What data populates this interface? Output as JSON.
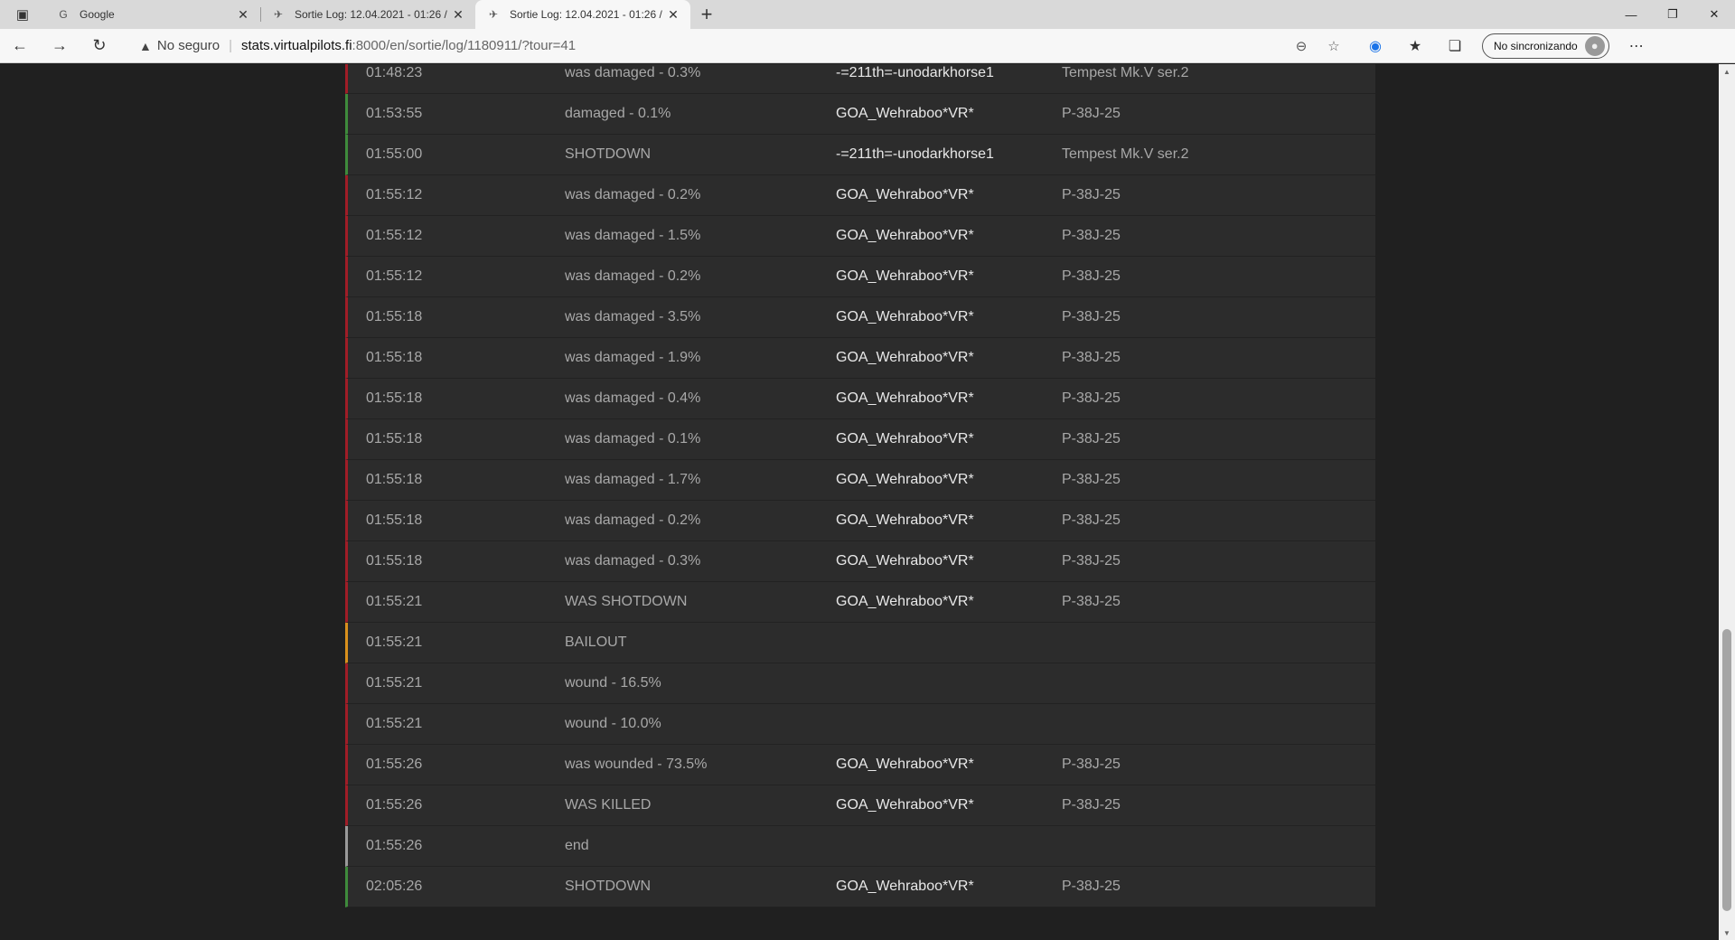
{
  "tabs": [
    {
      "title": "Google",
      "active": false
    },
    {
      "title": "Sortie Log: 12.04.2021 - 01:26 / ",
      "active": false
    },
    {
      "title": "Sortie Log: 12.04.2021 - 01:26 / ",
      "active": true
    }
  ],
  "address": {
    "security_label": "No seguro",
    "host": "stats.virtualpilots.fi",
    "path": ":8000/en/sortie/log/1180911/?tour=41"
  },
  "profile": {
    "label": "No sincronizando"
  },
  "log_rows": [
    {
      "time": "01:48:23",
      "event": "was damaged - 0.3%",
      "pilot": "-=211th=-unodarkhorse1",
      "aircraft": "Tempest Mk.V ser.2",
      "status_color": "#a01d27"
    },
    {
      "time": "01:53:55",
      "event": "damaged - 0.1%",
      "pilot": "GOA_Wehraboo*VR*",
      "aircraft": "P-38J-25",
      "status_color": "#3e8a3b"
    },
    {
      "time": "01:55:00",
      "event": "SHOTDOWN",
      "pilot": "-=211th=-unodarkhorse1",
      "aircraft": "Tempest Mk.V ser.2",
      "status_color": "#3e8a3b"
    },
    {
      "time": "01:55:12",
      "event": "was damaged - 0.2%",
      "pilot": "GOA_Wehraboo*VR*",
      "aircraft": "P-38J-25",
      "status_color": "#a01d27"
    },
    {
      "time": "01:55:12",
      "event": "was damaged - 1.5%",
      "pilot": "GOA_Wehraboo*VR*",
      "aircraft": "P-38J-25",
      "status_color": "#a01d27"
    },
    {
      "time": "01:55:12",
      "event": "was damaged - 0.2%",
      "pilot": "GOA_Wehraboo*VR*",
      "aircraft": "P-38J-25",
      "status_color": "#a01d27"
    },
    {
      "time": "01:55:18",
      "event": "was damaged - 3.5%",
      "pilot": "GOA_Wehraboo*VR*",
      "aircraft": "P-38J-25",
      "status_color": "#a01d27"
    },
    {
      "time": "01:55:18",
      "event": "was damaged - 1.9%",
      "pilot": "GOA_Wehraboo*VR*",
      "aircraft": "P-38J-25",
      "status_color": "#a01d27"
    },
    {
      "time": "01:55:18",
      "event": "was damaged - 0.4%",
      "pilot": "GOA_Wehraboo*VR*",
      "aircraft": "P-38J-25",
      "status_color": "#a01d27"
    },
    {
      "time": "01:55:18",
      "event": "was damaged - 0.1%",
      "pilot": "GOA_Wehraboo*VR*",
      "aircraft": "P-38J-25",
      "status_color": "#a01d27"
    },
    {
      "time": "01:55:18",
      "event": "was damaged - 1.7%",
      "pilot": "GOA_Wehraboo*VR*",
      "aircraft": "P-38J-25",
      "status_color": "#a01d27"
    },
    {
      "time": "01:55:18",
      "event": "was damaged - 0.2%",
      "pilot": "GOA_Wehraboo*VR*",
      "aircraft": "P-38J-25",
      "status_color": "#a01d27"
    },
    {
      "time": "01:55:18",
      "event": "was damaged - 0.3%",
      "pilot": "GOA_Wehraboo*VR*",
      "aircraft": "P-38J-25",
      "status_color": "#a01d27"
    },
    {
      "time": "01:55:21",
      "event": "WAS SHOTDOWN",
      "pilot": "GOA_Wehraboo*VR*",
      "aircraft": "P-38J-25",
      "status_color": "#a01d27"
    },
    {
      "time": "01:55:21",
      "event": "BAILOUT",
      "pilot": "",
      "aircraft": "",
      "status_color": "#d9901c"
    },
    {
      "time": "01:55:21",
      "event": "wound - 16.5%",
      "pilot": "",
      "aircraft": "",
      "status_color": "#a01d27"
    },
    {
      "time": "01:55:21",
      "event": "wound - 10.0%",
      "pilot": "",
      "aircraft": "",
      "status_color": "#a01d27"
    },
    {
      "time": "01:55:26",
      "event": "was wounded - 73.5%",
      "pilot": "GOA_Wehraboo*VR*",
      "aircraft": "P-38J-25",
      "status_color": "#a01d27"
    },
    {
      "time": "01:55:26",
      "event": "WAS KILLED",
      "pilot": "GOA_Wehraboo*VR*",
      "aircraft": "P-38J-25",
      "status_color": "#a01d27"
    },
    {
      "time": "01:55:26",
      "event": "end",
      "pilot": "",
      "aircraft": "",
      "status_color": "#9a9a9a"
    },
    {
      "time": "02:05:26",
      "event": "SHOTDOWN",
      "pilot": "GOA_Wehraboo*VR*",
      "aircraft": "P-38J-25",
      "status_color": "#3e8a3b"
    }
  ]
}
